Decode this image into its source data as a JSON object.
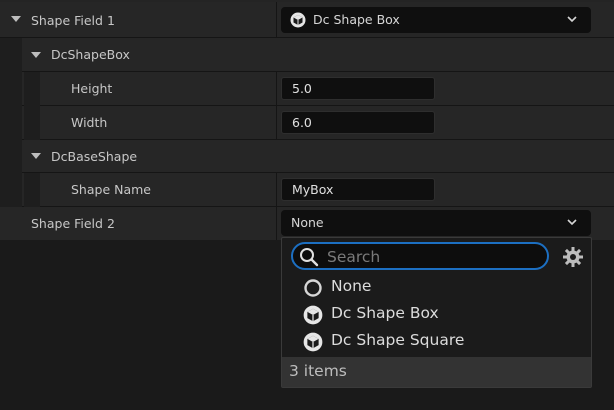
{
  "properties": {
    "shape_field_1": {
      "label": "Shape Field 1",
      "value": "Dc Shape Box",
      "icon": "cube-icon"
    },
    "dc_shape_box_category": {
      "label": "DcShapeBox"
    },
    "height": {
      "label": "Height",
      "value": "5.0"
    },
    "width": {
      "label": "Width",
      "value": "6.0"
    },
    "dc_base_shape_category": {
      "label": "DcBaseShape"
    },
    "shape_name": {
      "label": "Shape Name",
      "value": "MyBox"
    },
    "shape_field_2": {
      "label": "Shape Field 2",
      "value": "None"
    }
  },
  "dropdown": {
    "search_placeholder": "Search",
    "items": [
      {
        "label": "None",
        "icon": "ring-icon"
      },
      {
        "label": "Dc Shape Box",
        "icon": "cube-icon"
      },
      {
        "label": "Dc Shape Square",
        "icon": "cube-icon"
      }
    ],
    "footer": "3 items"
  },
  "colors": {
    "accent": "#1c6fc2",
    "panel": "#242424",
    "field": "#0f0f0f"
  }
}
